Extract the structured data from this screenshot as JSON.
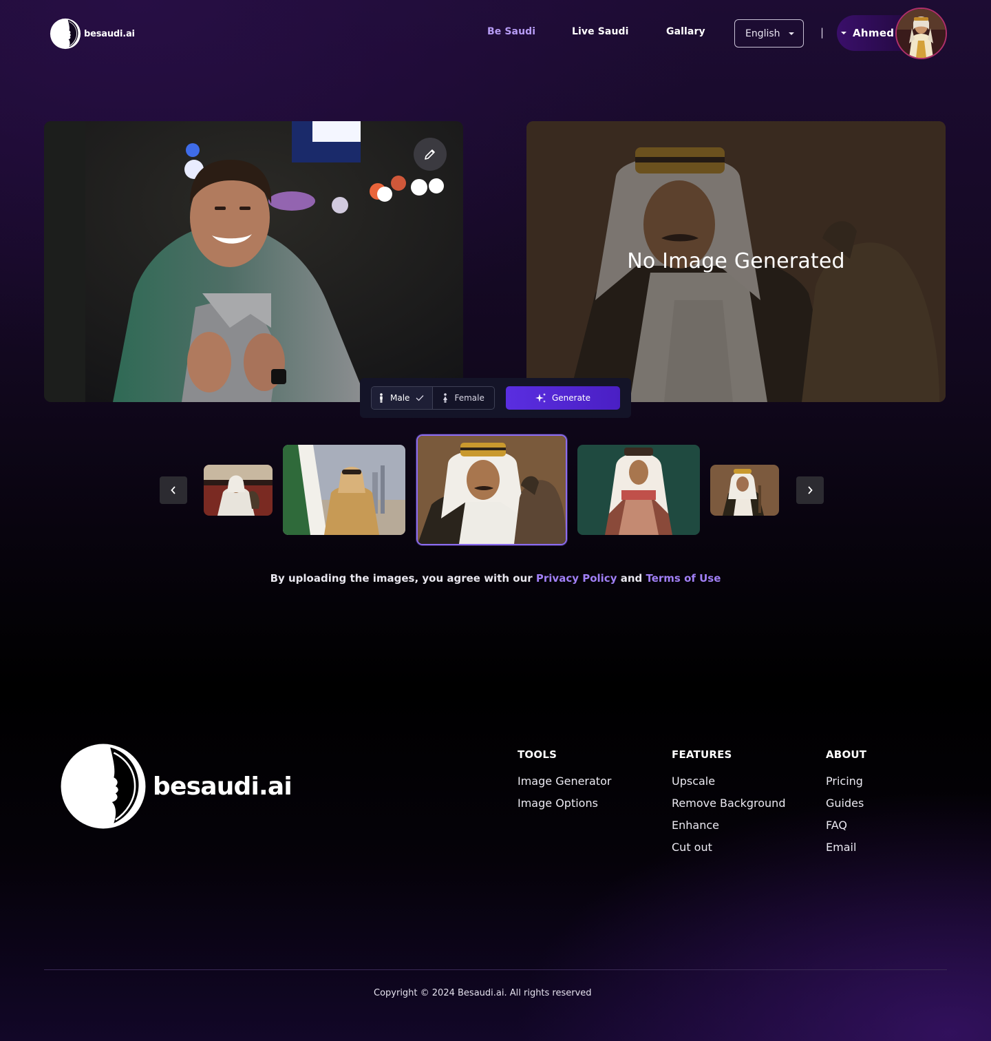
{
  "header": {
    "logo_text": "besaudi.ai",
    "nav": [
      "Be Saudi",
      "Live Saudi",
      "Gallary"
    ],
    "language": "English",
    "separator": "|",
    "user_name": "Ahmed"
  },
  "main": {
    "output_placeholder": "No Image Generated",
    "gender_options": [
      "Male",
      "Female"
    ],
    "selected_gender": "Male",
    "generate_label": "Generate"
  },
  "consent": {
    "prefix": "By uploading the images, you agree with our",
    "privacy": "Privacy Policy",
    "conjunction": "and",
    "terms": "Terms of Use"
  },
  "footer": {
    "logo_text": "besaudi.ai",
    "columns": [
      {
        "heading": "TOOLS",
        "links": [
          "Image Generator",
          "Image Options"
        ]
      },
      {
        "heading": "FEATURES",
        "links": [
          "Upscale",
          "Remove Background",
          "Enhance",
          "Cut out"
        ]
      },
      {
        "heading": "ABOUT",
        "links": [
          "Pricing",
          "Guides",
          "FAQ",
          "Email"
        ]
      }
    ],
    "copyright": "Copyright © 2024 Besaudi.ai. All rights reserved"
  },
  "colors": {
    "accent": "#8b6cf0",
    "active_nav": "#b79cf5",
    "link": "#a07ff5",
    "generate_button": "#5a2ee0"
  },
  "icons": [
    "logo-face-icon",
    "chevron-down-icon",
    "pencil-icon",
    "person-icon",
    "check-icon",
    "sparkle-icon",
    "chevron-left-icon",
    "chevron-right-icon"
  ]
}
